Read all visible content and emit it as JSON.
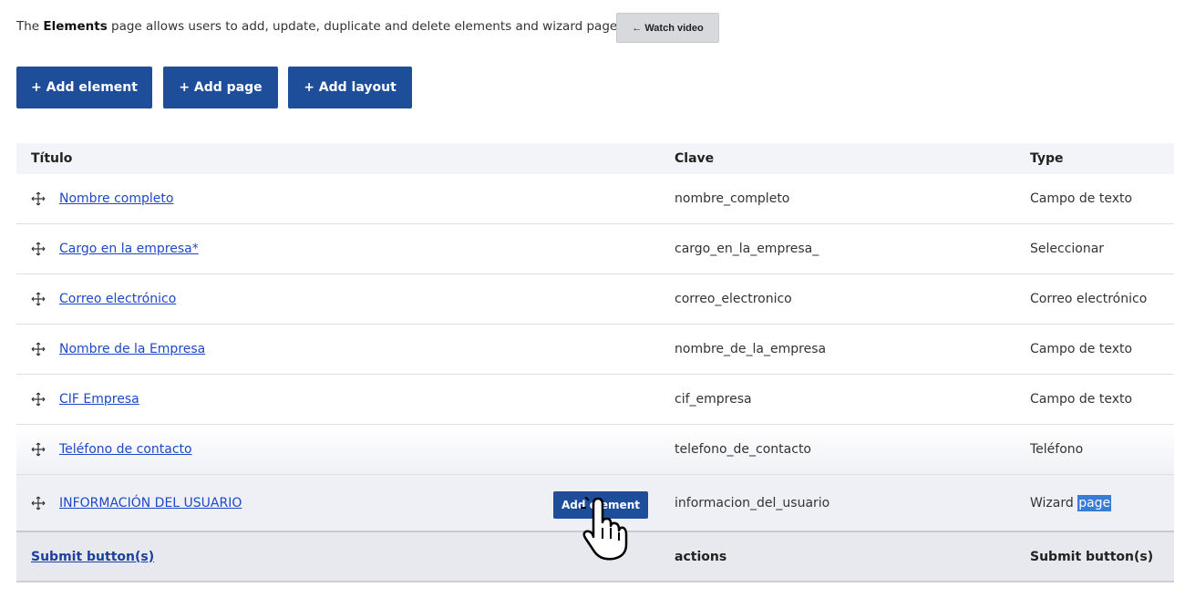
{
  "intro": {
    "prefix": "The ",
    "bold": "Elements",
    "suffix": " page allows users to add, update, duplicate and delete elements and wizard pages.",
    "watch_video": "← Watch video"
  },
  "actions": {
    "add_element": "+ Add element",
    "add_page": "+ Add page",
    "add_layout": "+ Add layout"
  },
  "table": {
    "headers": [
      "Título",
      "Clave",
      "Type"
    ],
    "rows": [
      {
        "title": "Nombre completo",
        "key": "nombre_completo",
        "type": "Campo de texto"
      },
      {
        "title": "Cargo en la empresa*",
        "key": "cargo_en_la_empresa_",
        "type": "Seleccionar"
      },
      {
        "title": "Correo electrónico",
        "key": "correo_electronico",
        "type": "Correo electrónico"
      },
      {
        "title": "Nombre de la Empresa",
        "key": "nombre_de_la_empresa",
        "type": "Campo de texto"
      },
      {
        "title": "CIF Empresa",
        "key": "cif_empresa",
        "type": "Campo de texto"
      },
      {
        "title": "Teléfono de contacto",
        "key": "telefono_de_contacto",
        "type": "Teléfono"
      },
      {
        "title": "INFORMACIÓN DEL USUARIO",
        "key": "informacion_del_usuario",
        "type_prefix": "Wizard ",
        "type_selected": "page",
        "inline_button": "Add element"
      }
    ],
    "footer": {
      "title": "Submit button(s)",
      "key": "actions",
      "type": "Submit button(s)"
    }
  },
  "colors": {
    "primary": "#1e4e9a",
    "link": "#1f48c8",
    "header_bg": "#f3f4f9",
    "selection": "#3a7bd5"
  },
  "icons": {
    "drag": "drag-handle-icon",
    "cursor": "hand-pointer-cursor"
  }
}
